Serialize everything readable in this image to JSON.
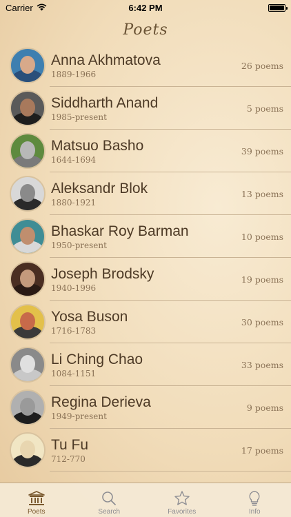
{
  "status_bar": {
    "carrier": "Carrier",
    "time": "6:42 PM"
  },
  "nav": {
    "title": "Poets"
  },
  "poets": [
    {
      "name": "Anna Akhmatova",
      "years": "1889-1966",
      "poems": "26 poems",
      "avatar": {
        "bg": "#3e7fb0",
        "face": "#d8a98a",
        "body": "#2a4f7a"
      }
    },
    {
      "name": "Siddharth Anand",
      "years": "1985-present",
      "poems": "5 poems",
      "avatar": {
        "bg": "#5a5a5a",
        "face": "#a8795c",
        "body": "#1e1e1e"
      }
    },
    {
      "name": "Matsuo Basho",
      "years": "1644-1694",
      "poems": "39 poems",
      "avatar": {
        "bg": "#5e8a3e",
        "face": "#b8b8b8",
        "body": "#7a7a7a"
      }
    },
    {
      "name": "Aleksandr Blok",
      "years": "1880-1921",
      "poems": "13 poems",
      "avatar": {
        "bg": "#d8d8d8",
        "face": "#8a8a8a",
        "body": "#2a2a2a"
      }
    },
    {
      "name": "Bhaskar Roy Barman",
      "years": "1950-present",
      "poems": "10 poems",
      "avatar": {
        "bg": "#3f8d95",
        "face": "#c08e6e",
        "body": "#d8d8d8"
      }
    },
    {
      "name": "Joseph Brodsky",
      "years": "1940-1996",
      "poems": "19 poems",
      "avatar": {
        "bg": "#4a2e22",
        "face": "#c49a7c",
        "body": "#2a1a14"
      }
    },
    {
      "name": "Yosa Buson",
      "years": "1716-1783",
      "poems": "30 poems",
      "avatar": {
        "bg": "#e3c04a",
        "face": "#c76a4a",
        "body": "#3a3a3a"
      }
    },
    {
      "name": "Li Ching Chao",
      "years": "1084-1151",
      "poems": "33 poems",
      "avatar": {
        "bg": "#8a8a8a",
        "face": "#e0e0e0",
        "body": "#c8c8c8"
      }
    },
    {
      "name": "Regina Derieva",
      "years": "1949-present",
      "poems": "9 poems",
      "avatar": {
        "bg": "#b0b0b0",
        "face": "#9a9a9a",
        "body": "#1e1e1e"
      }
    },
    {
      "name": "Tu Fu",
      "years": "712-770",
      "poems": "17 poems",
      "avatar": {
        "bg": "#f1e6c4",
        "face": "#e8d6b0",
        "body": "#2a2a2a"
      }
    }
  ],
  "tabs": [
    {
      "label": "Poets",
      "icon": "building-columns-icon",
      "active": true
    },
    {
      "label": "Search",
      "icon": "magnifier-icon",
      "active": false
    },
    {
      "label": "Favorites",
      "icon": "star-icon",
      "active": false
    },
    {
      "label": "Info",
      "icon": "lightbulb-icon",
      "active": false
    }
  ],
  "colors": {
    "accent": "#7a5a30",
    "tab_inactive": "#8e8e93",
    "background": "#f1dcb9"
  }
}
